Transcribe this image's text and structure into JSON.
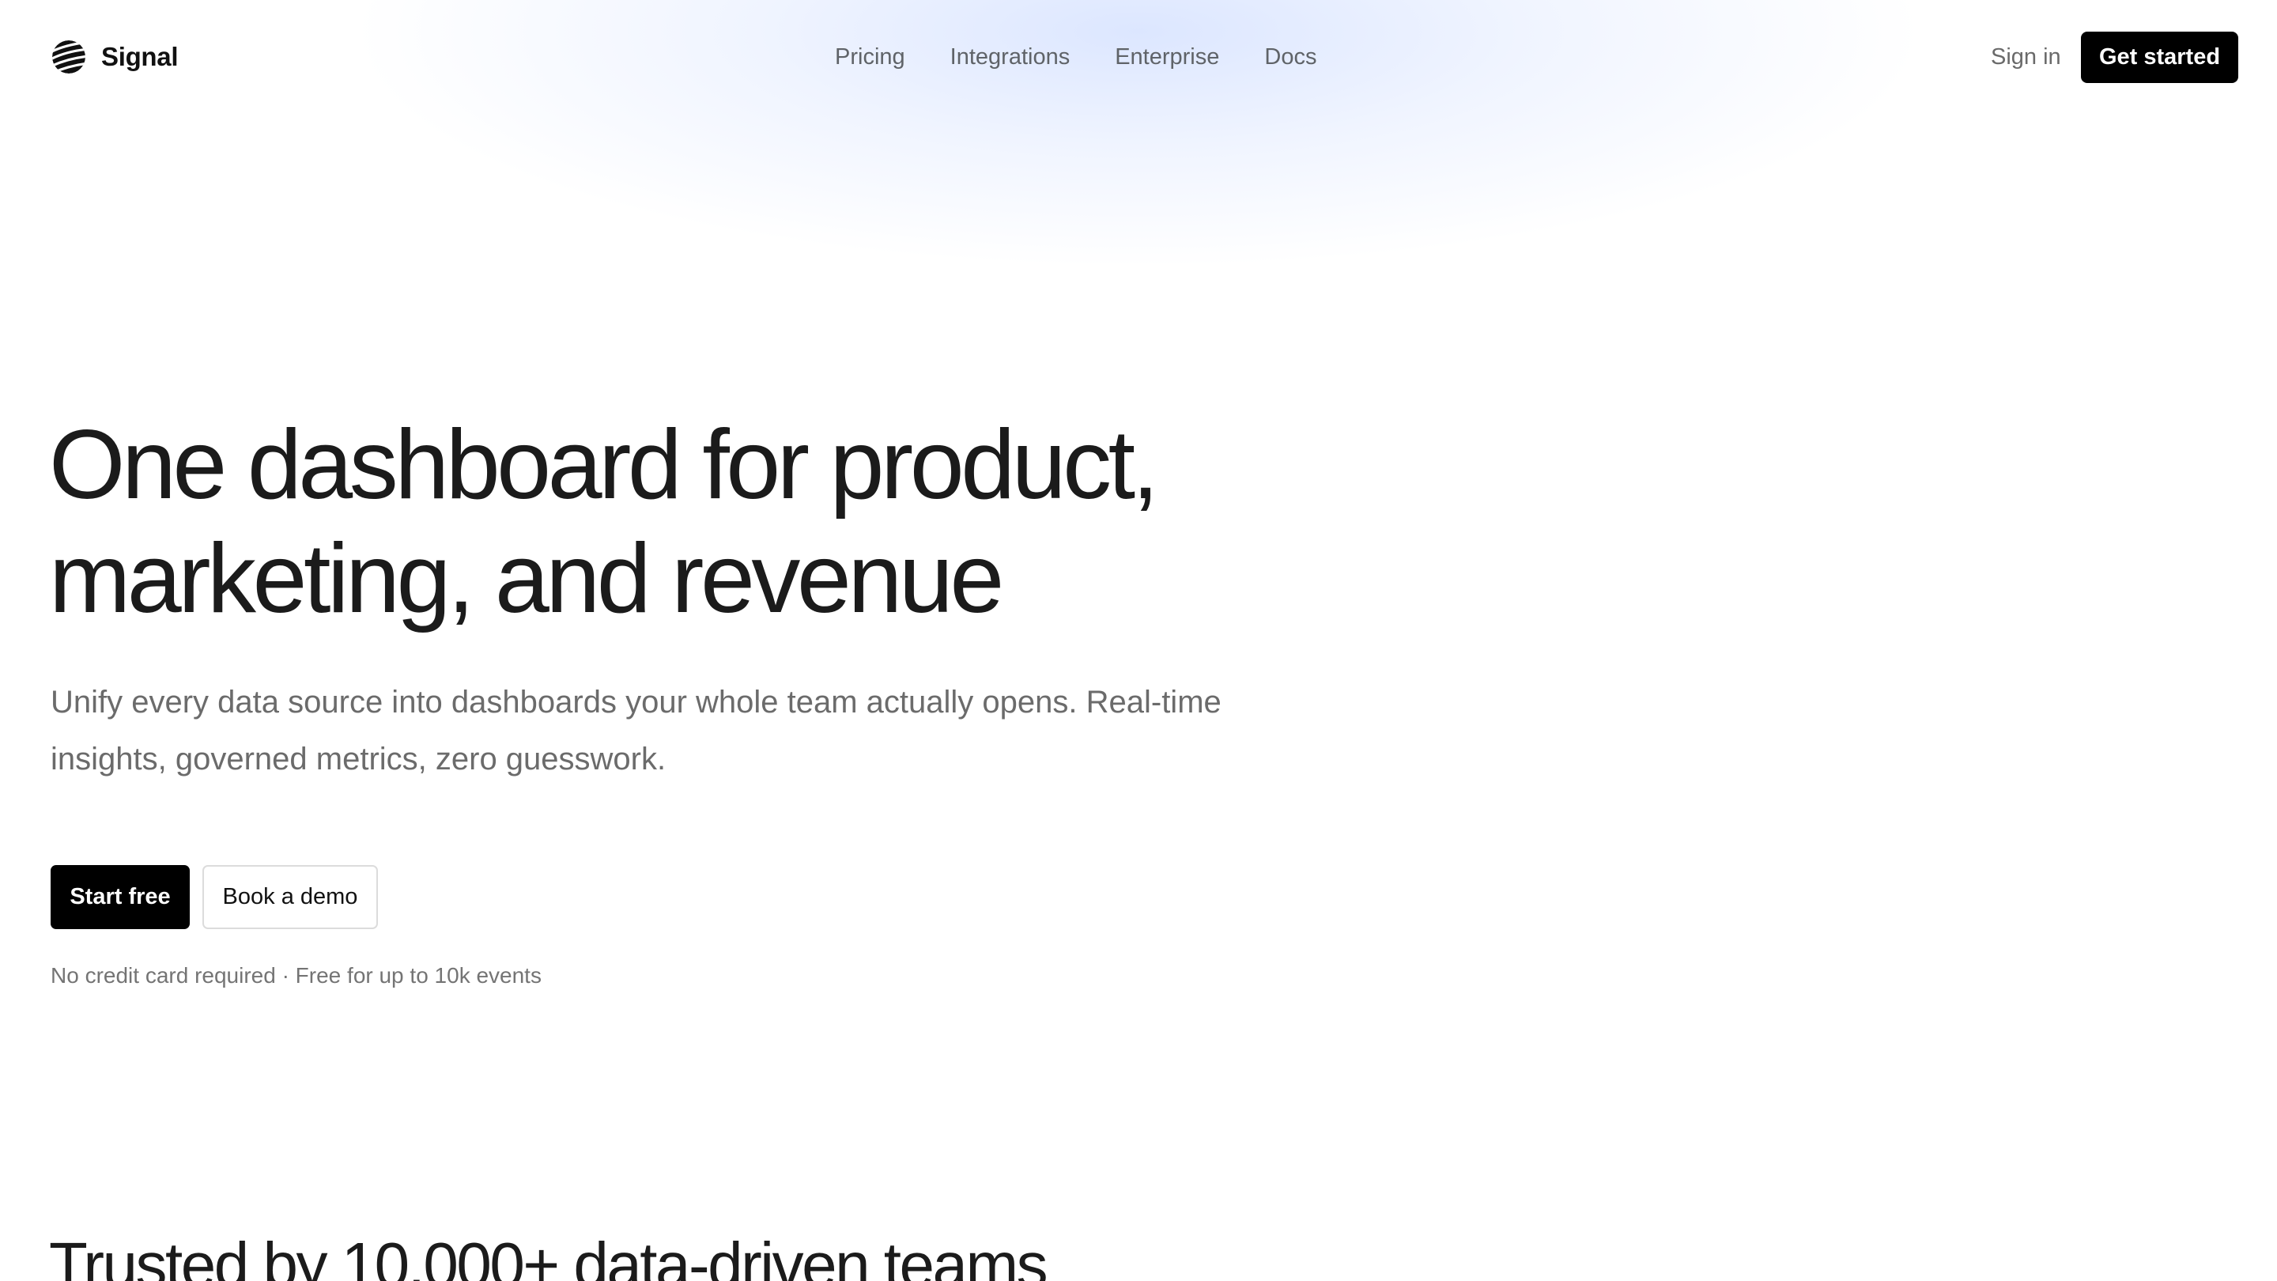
{
  "brand": {
    "name": "Signal",
    "logo_icon": "striped-sphere-icon"
  },
  "nav": {
    "items": [
      {
        "label": "Pricing"
      },
      {
        "label": "Integrations"
      },
      {
        "label": "Enterprise"
      },
      {
        "label": "Docs"
      }
    ]
  },
  "header": {
    "signin_label": "Sign in",
    "cta_label": "Get started"
  },
  "hero": {
    "title_line1": "One dashboard for product,",
    "title_line2": "marketing, and revenue",
    "subtitle": "Unify every data source into dashboards your whole team actually opens. Real-time insights, governed metrics, zero guesswork.",
    "primary_cta": "Start free",
    "secondary_cta": "Book a demo",
    "note": "No credit card required · Free for up to 10k events"
  },
  "social_proof": {
    "heading": "Trusted by 10,000+ data-driven teams"
  },
  "colors": {
    "primary_button": "#000000",
    "glow": "#dbe5ff",
    "text_muted": "#6b6b6b"
  }
}
